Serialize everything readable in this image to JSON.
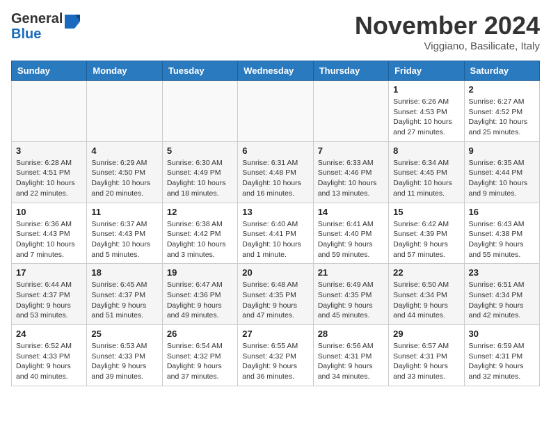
{
  "header": {
    "logo_line1": "General",
    "logo_line2": "Blue",
    "month": "November 2024",
    "location": "Viggiano, Basilicate, Italy"
  },
  "weekdays": [
    "Sunday",
    "Monday",
    "Tuesday",
    "Wednesday",
    "Thursday",
    "Friday",
    "Saturday"
  ],
  "weeks": [
    [
      {
        "day": "",
        "detail": ""
      },
      {
        "day": "",
        "detail": ""
      },
      {
        "day": "",
        "detail": ""
      },
      {
        "day": "",
        "detail": ""
      },
      {
        "day": "",
        "detail": ""
      },
      {
        "day": "1",
        "detail": "Sunrise: 6:26 AM\nSunset: 4:53 PM\nDaylight: 10 hours\nand 27 minutes."
      },
      {
        "day": "2",
        "detail": "Sunrise: 6:27 AM\nSunset: 4:52 PM\nDaylight: 10 hours\nand 25 minutes."
      }
    ],
    [
      {
        "day": "3",
        "detail": "Sunrise: 6:28 AM\nSunset: 4:51 PM\nDaylight: 10 hours\nand 22 minutes."
      },
      {
        "day": "4",
        "detail": "Sunrise: 6:29 AM\nSunset: 4:50 PM\nDaylight: 10 hours\nand 20 minutes."
      },
      {
        "day": "5",
        "detail": "Sunrise: 6:30 AM\nSunset: 4:49 PM\nDaylight: 10 hours\nand 18 minutes."
      },
      {
        "day": "6",
        "detail": "Sunrise: 6:31 AM\nSunset: 4:48 PM\nDaylight: 10 hours\nand 16 minutes."
      },
      {
        "day": "7",
        "detail": "Sunrise: 6:33 AM\nSunset: 4:46 PM\nDaylight: 10 hours\nand 13 minutes."
      },
      {
        "day": "8",
        "detail": "Sunrise: 6:34 AM\nSunset: 4:45 PM\nDaylight: 10 hours\nand 11 minutes."
      },
      {
        "day": "9",
        "detail": "Sunrise: 6:35 AM\nSunset: 4:44 PM\nDaylight: 10 hours\nand 9 minutes."
      }
    ],
    [
      {
        "day": "10",
        "detail": "Sunrise: 6:36 AM\nSunset: 4:43 PM\nDaylight: 10 hours\nand 7 minutes."
      },
      {
        "day": "11",
        "detail": "Sunrise: 6:37 AM\nSunset: 4:43 PM\nDaylight: 10 hours\nand 5 minutes."
      },
      {
        "day": "12",
        "detail": "Sunrise: 6:38 AM\nSunset: 4:42 PM\nDaylight: 10 hours\nand 3 minutes."
      },
      {
        "day": "13",
        "detail": "Sunrise: 6:40 AM\nSunset: 4:41 PM\nDaylight: 10 hours\nand 1 minute."
      },
      {
        "day": "14",
        "detail": "Sunrise: 6:41 AM\nSunset: 4:40 PM\nDaylight: 9 hours\nand 59 minutes."
      },
      {
        "day": "15",
        "detail": "Sunrise: 6:42 AM\nSunset: 4:39 PM\nDaylight: 9 hours\nand 57 minutes."
      },
      {
        "day": "16",
        "detail": "Sunrise: 6:43 AM\nSunset: 4:38 PM\nDaylight: 9 hours\nand 55 minutes."
      }
    ],
    [
      {
        "day": "17",
        "detail": "Sunrise: 6:44 AM\nSunset: 4:37 PM\nDaylight: 9 hours\nand 53 minutes."
      },
      {
        "day": "18",
        "detail": "Sunrise: 6:45 AM\nSunset: 4:37 PM\nDaylight: 9 hours\nand 51 minutes."
      },
      {
        "day": "19",
        "detail": "Sunrise: 6:47 AM\nSunset: 4:36 PM\nDaylight: 9 hours\nand 49 minutes."
      },
      {
        "day": "20",
        "detail": "Sunrise: 6:48 AM\nSunset: 4:35 PM\nDaylight: 9 hours\nand 47 minutes."
      },
      {
        "day": "21",
        "detail": "Sunrise: 6:49 AM\nSunset: 4:35 PM\nDaylight: 9 hours\nand 45 minutes."
      },
      {
        "day": "22",
        "detail": "Sunrise: 6:50 AM\nSunset: 4:34 PM\nDaylight: 9 hours\nand 44 minutes."
      },
      {
        "day": "23",
        "detail": "Sunrise: 6:51 AM\nSunset: 4:34 PM\nDaylight: 9 hours\nand 42 minutes."
      }
    ],
    [
      {
        "day": "24",
        "detail": "Sunrise: 6:52 AM\nSunset: 4:33 PM\nDaylight: 9 hours\nand 40 minutes."
      },
      {
        "day": "25",
        "detail": "Sunrise: 6:53 AM\nSunset: 4:33 PM\nDaylight: 9 hours\nand 39 minutes."
      },
      {
        "day": "26",
        "detail": "Sunrise: 6:54 AM\nSunset: 4:32 PM\nDaylight: 9 hours\nand 37 minutes."
      },
      {
        "day": "27",
        "detail": "Sunrise: 6:55 AM\nSunset: 4:32 PM\nDaylight: 9 hours\nand 36 minutes."
      },
      {
        "day": "28",
        "detail": "Sunrise: 6:56 AM\nSunset: 4:31 PM\nDaylight: 9 hours\nand 34 minutes."
      },
      {
        "day": "29",
        "detail": "Sunrise: 6:57 AM\nSunset: 4:31 PM\nDaylight: 9 hours\nand 33 minutes."
      },
      {
        "day": "30",
        "detail": "Sunrise: 6:59 AM\nSunset: 4:31 PM\nDaylight: 9 hours\nand 32 minutes."
      }
    ]
  ]
}
